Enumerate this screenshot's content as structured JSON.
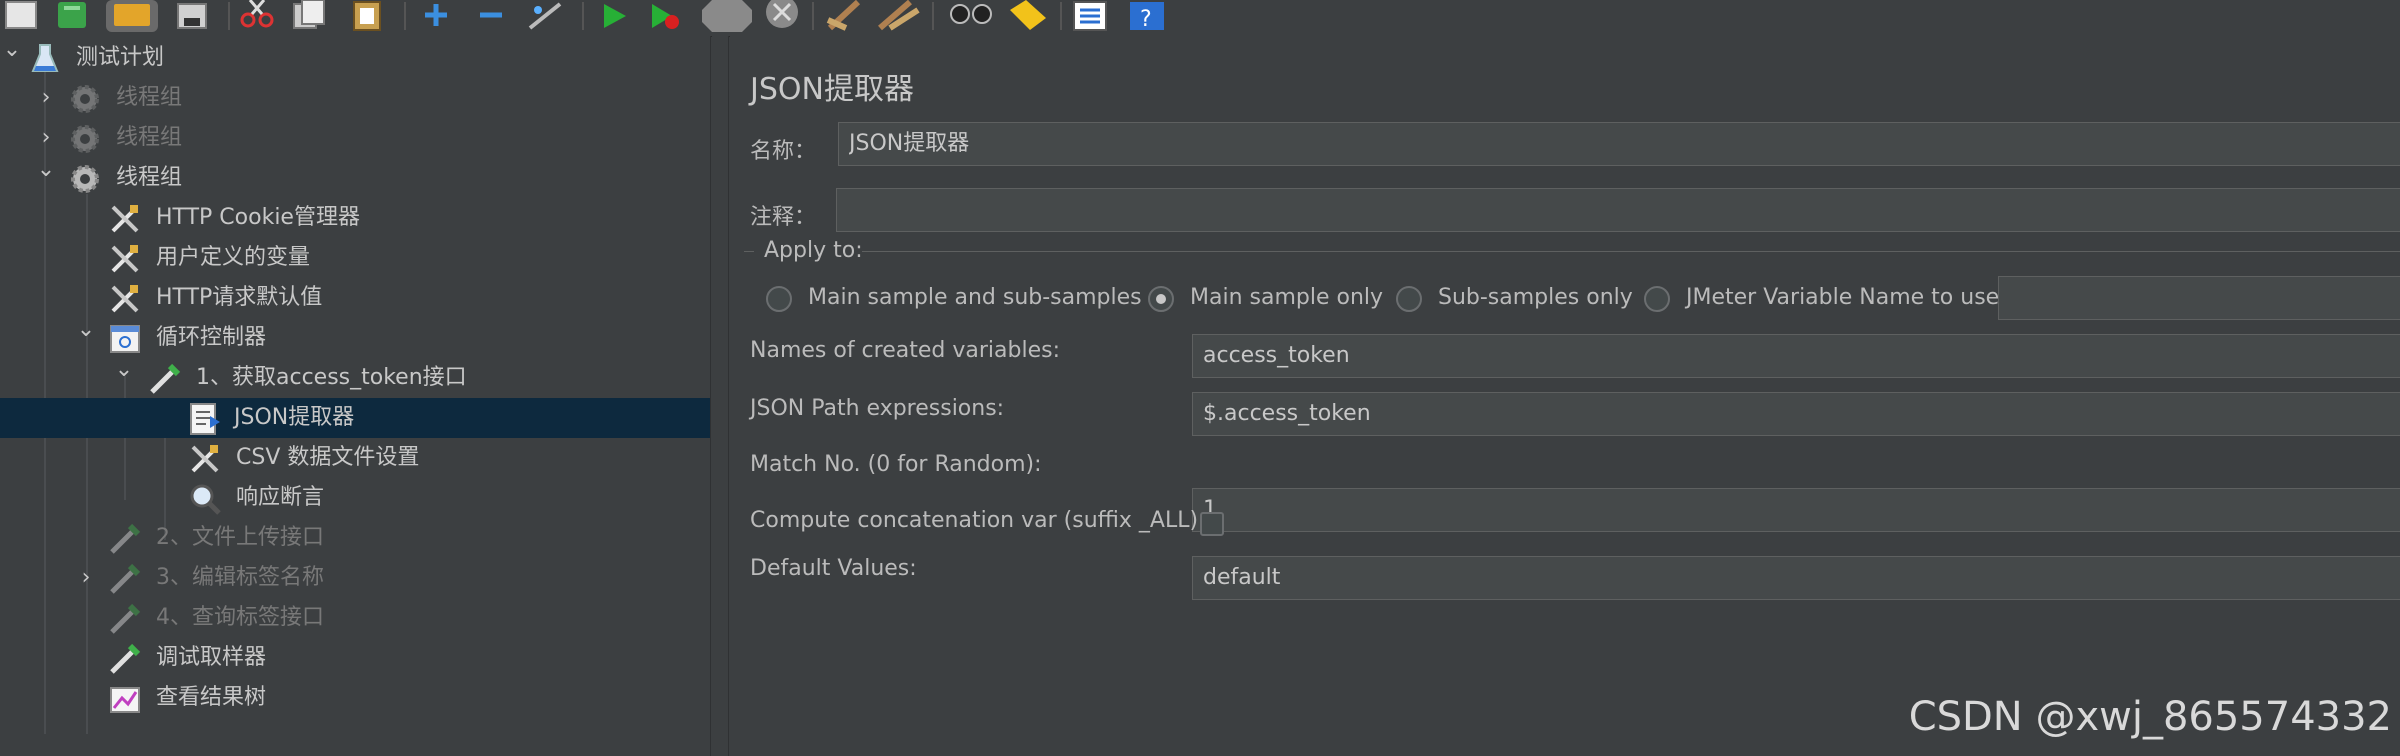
{
  "toolbar": {
    "icons": [
      "new-icon",
      "templates-icon",
      "open-icon",
      "save-icon",
      "cut-icon",
      "copy-icon",
      "paste-icon",
      "expand-icon",
      "collapse-icon",
      "toggle-icon",
      "start-icon",
      "start-no-pause-icon",
      "stop-icon",
      "shutdown-icon",
      "clear-icon",
      "clear-all-icon",
      "search-icon",
      "reset-search-icon",
      "function-helper-icon",
      "help-icon"
    ]
  },
  "tree": {
    "items": [
      {
        "label": "测试计划",
        "state": "normal",
        "icon": "test-plan-icon",
        "arrow": "expanded"
      },
      {
        "label": "线程组",
        "state": "disabled",
        "icon": "thread-group-icon",
        "arrow": "collapsed"
      },
      {
        "label": "线程组",
        "state": "disabled",
        "icon": "thread-group-icon",
        "arrow": "collapsed"
      },
      {
        "label": "线程组",
        "state": "normal",
        "icon": "thread-group-icon",
        "arrow": "expanded"
      },
      {
        "label": "HTTP Cookie管理器",
        "state": "normal",
        "icon": "config-element-icon",
        "arrow": ""
      },
      {
        "label": "用户定义的变量",
        "state": "normal",
        "icon": "config-element-icon",
        "arrow": ""
      },
      {
        "label": "HTTP请求默认值",
        "state": "normal",
        "icon": "config-element-icon",
        "arrow": ""
      },
      {
        "label": "循环控制器",
        "state": "normal",
        "icon": "loop-controller-icon",
        "arrow": "expanded"
      },
      {
        "label": "1、获取access_token接口",
        "state": "normal",
        "icon": "sampler-pipette-icon",
        "arrow": "expanded"
      },
      {
        "label": "JSON提取器",
        "state": "selected",
        "icon": "post-processor-icon",
        "arrow": ""
      },
      {
        "label": "CSV 数据文件设置",
        "state": "normal",
        "icon": "config-element-icon",
        "arrow": ""
      },
      {
        "label": "响应断言",
        "state": "normal",
        "icon": "assertion-magnifier-icon",
        "arrow": ""
      },
      {
        "label": "2、文件上传接口",
        "state": "disabled",
        "icon": "sampler-pipette-icon",
        "arrow": ""
      },
      {
        "label": "3、编辑标签名称",
        "state": "disabled",
        "icon": "sampler-pipette-icon",
        "arrow": "collapsed"
      },
      {
        "label": "4、查询标签接口",
        "state": "disabled",
        "icon": "sampler-pipette-icon",
        "arrow": ""
      },
      {
        "label": "调试取样器",
        "state": "normal",
        "icon": "sampler-pipette-icon",
        "arrow": ""
      },
      {
        "label": "查看结果树",
        "state": "normal",
        "icon": "listener-chart-icon",
        "arrow": ""
      }
    ]
  },
  "panel": {
    "title": "JSON提取器",
    "name_label": "名称：",
    "name_value": "JSON提取器",
    "comment_label": "注释：",
    "comment_value": "",
    "apply_to_label": "Apply to:",
    "apply_options": [
      {
        "label": "Main sample and sub-samples",
        "selected": false
      },
      {
        "label": "Main sample only",
        "selected": true
      },
      {
        "label": "Sub-samples only",
        "selected": false
      },
      {
        "label": "JMeter Variable Name to use",
        "selected": false
      }
    ],
    "jmeter_var_value": "",
    "variables_label": "Names of created variables:",
    "variables_value": "access_token",
    "json_path_label": "JSON Path expressions:",
    "json_path_value": "$.access_token",
    "match_no_label": "Match No. (0 for Random):",
    "match_no_value": "1",
    "concat_label": "Compute concatenation var (suffix _ALL):",
    "concat_checked": false,
    "default_label": "Default Values:",
    "default_value": "default"
  },
  "watermark": "CSDN @xwj_865574332"
}
